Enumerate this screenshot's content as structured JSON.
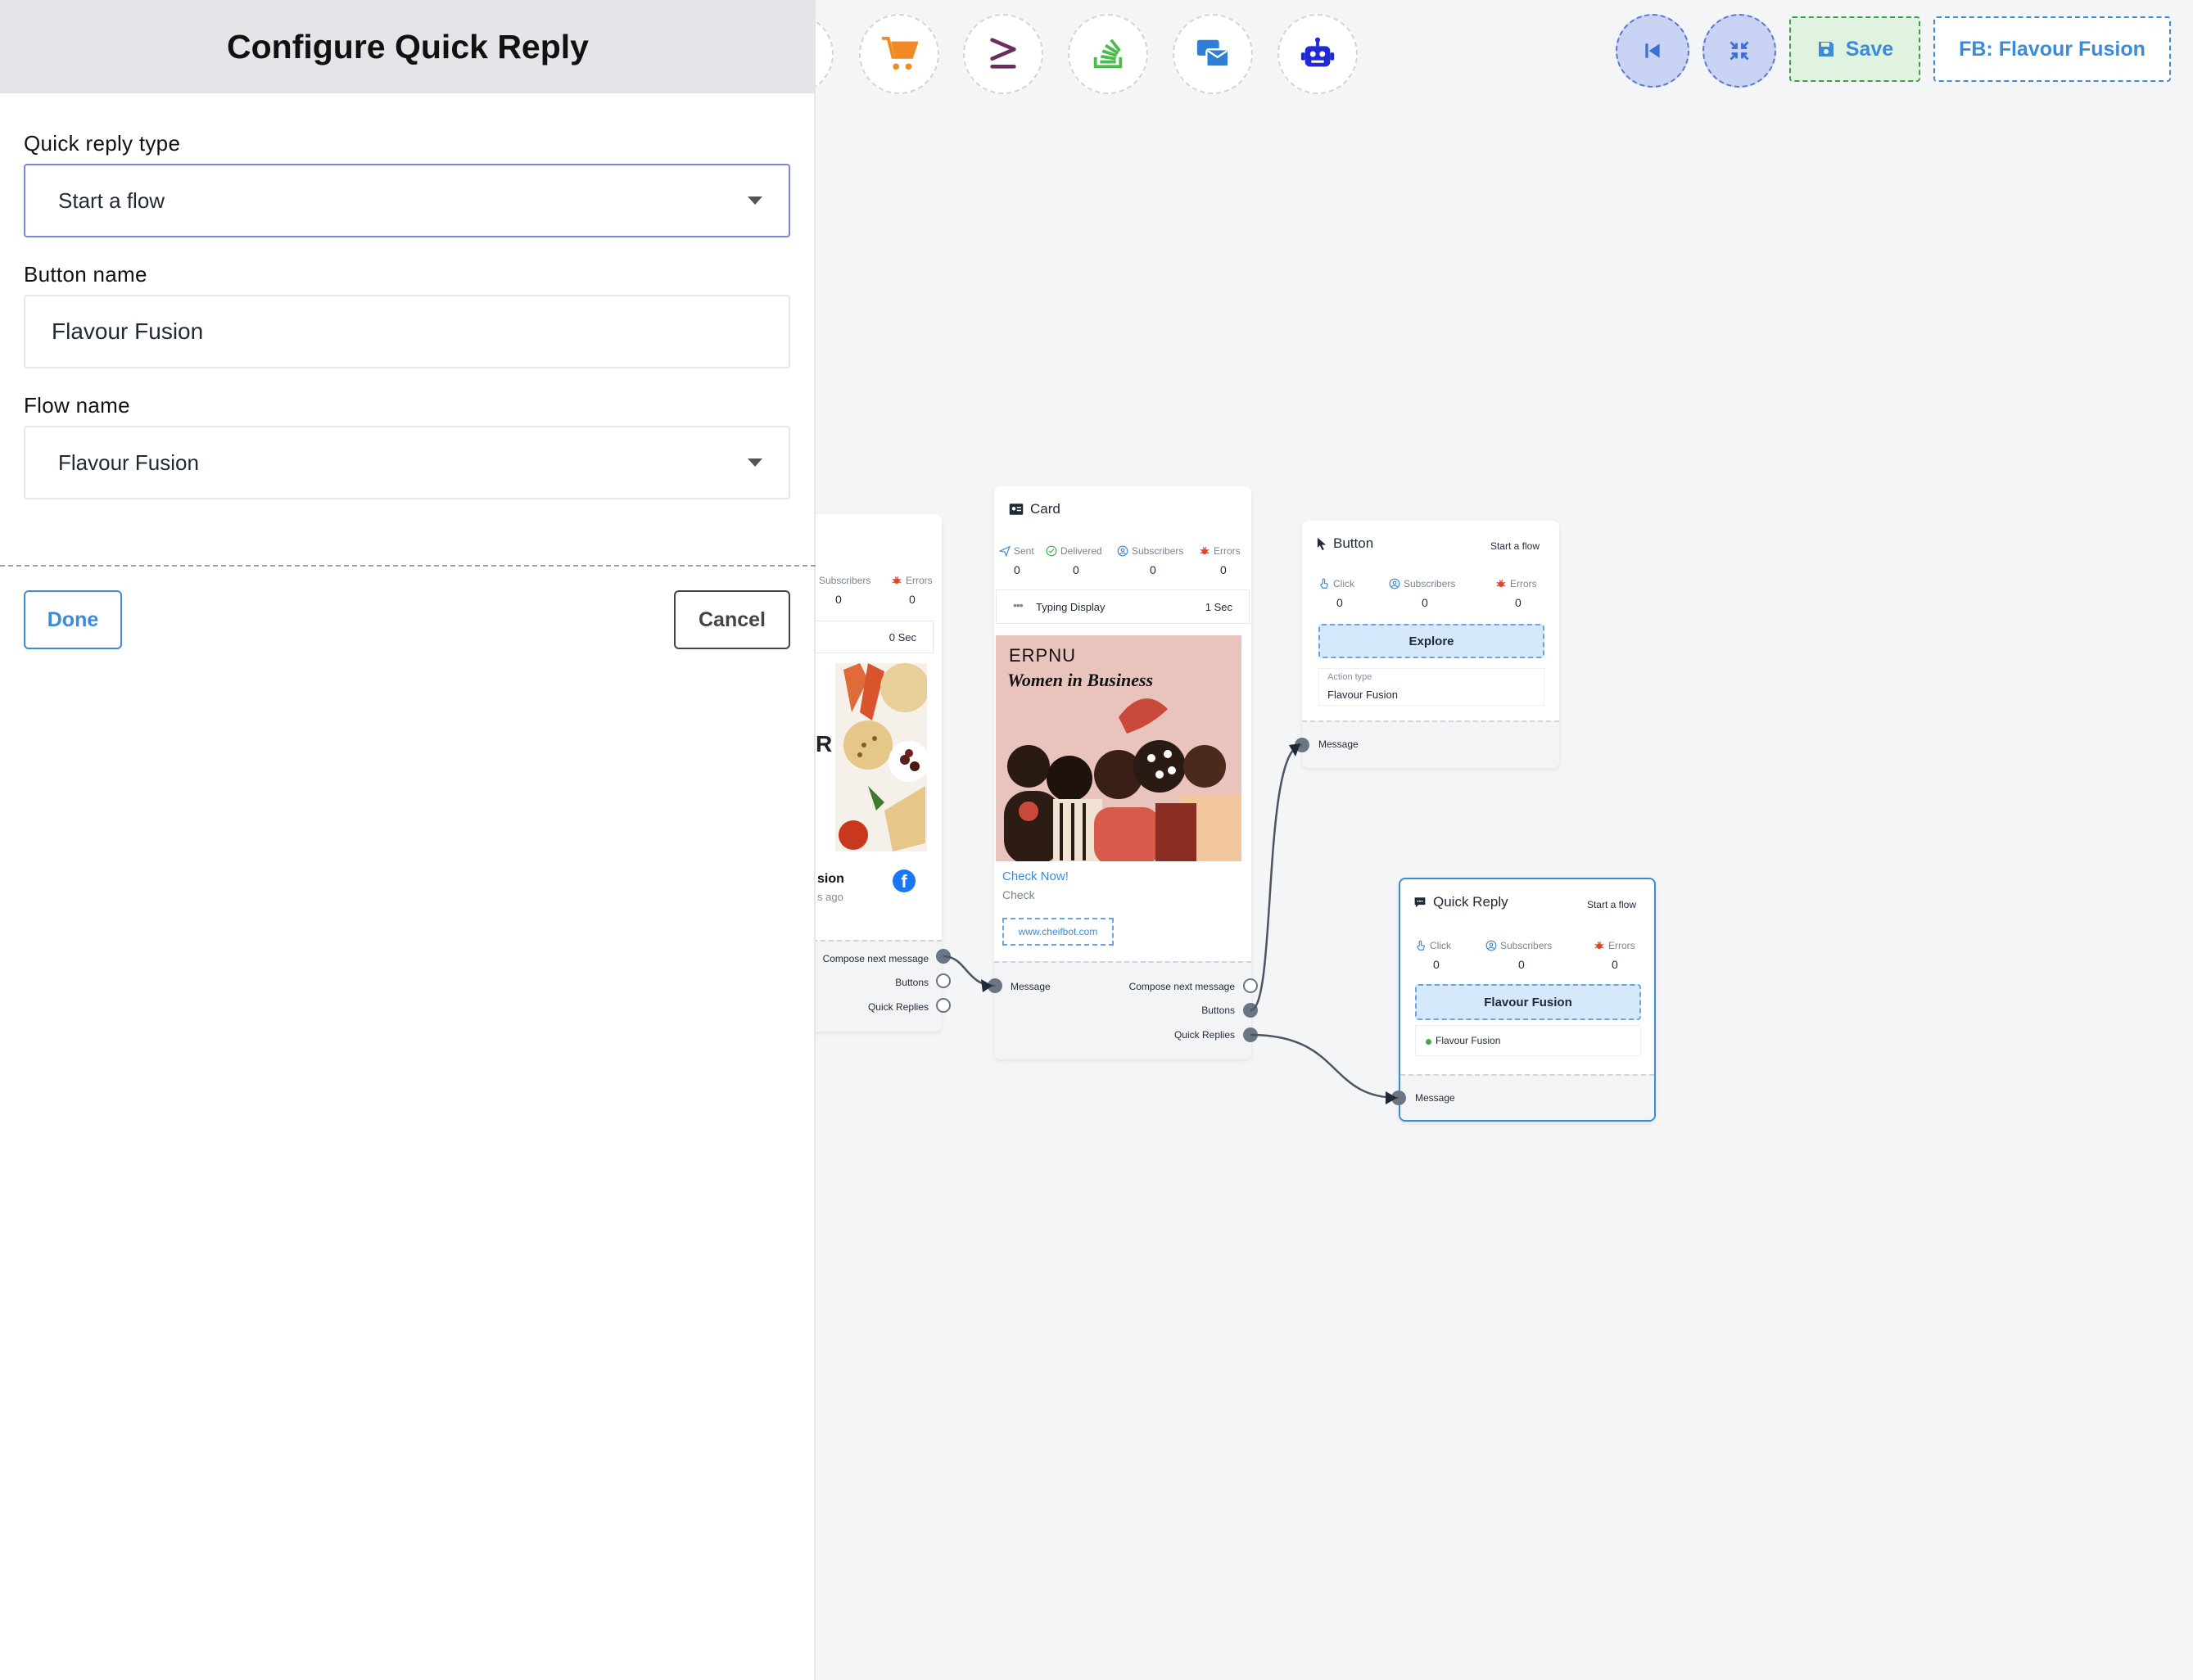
{
  "panel": {
    "title": "Configure Quick Reply",
    "quick_reply_type": {
      "label": "Quick reply type",
      "value": "Start a flow"
    },
    "button_name": {
      "label": "Button name",
      "value": "Flavour Fusion"
    },
    "flow_name": {
      "label": "Flow name",
      "value": "Flavour Fusion"
    },
    "done_label": "Done",
    "cancel_label": "Cancel"
  },
  "toolbar": {
    "tools": [
      "cart-icon",
      "greater-equal-icon",
      "stack-icon",
      "messages-icon",
      "robot-icon"
    ],
    "save_label": "Save",
    "flow_label": "FB: Flavour Fusion",
    "colors": {
      "accent": "#3b8bd9",
      "save_bg": "#dff3e0",
      "round_bg": "#c9d3f3"
    }
  },
  "nodes": {
    "partial": {
      "subscribers_label": "Subscribers",
      "errors_label": "Errors",
      "subscribers_value": "0",
      "errors_value": "0",
      "delay": "0 Sec",
      "title_fragment": "sion",
      "time_fragment": "s ago",
      "ports": [
        "Compose next message",
        "Buttons",
        "Quick Replies"
      ]
    },
    "card": {
      "title": "Card",
      "stats": [
        {
          "label": "Sent",
          "value": "0"
        },
        {
          "label": "Delivered",
          "value": "0"
        },
        {
          "label": "Subscribers",
          "value": "0"
        },
        {
          "label": "Errors",
          "value": "0"
        }
      ],
      "typing_label": "Typing Display",
      "typing_value": "1 Sec",
      "image_heading": "ERPNU",
      "image_subheading": "Women in Business",
      "link_title": "Check Now!",
      "link_subtitle": "Check",
      "url": "www.cheifbot.com",
      "input_port": "Message",
      "ports": [
        "Compose next message",
        "Buttons",
        "Quick Replies"
      ]
    },
    "button": {
      "title": "Button",
      "tag": "Start a flow",
      "stats": [
        {
          "label": "Click",
          "value": "0"
        },
        {
          "label": "Subscribers",
          "value": "0"
        },
        {
          "label": "Errors",
          "value": "0"
        }
      ],
      "chip": "Explore",
      "action_type_label": "Action type",
      "action_type_value": "Flavour Fusion",
      "input_port": "Message"
    },
    "quick_reply": {
      "title": "Quick Reply",
      "tag": "Start a flow",
      "stats": [
        {
          "label": "Click",
          "value": "0"
        },
        {
          "label": "Subscribers",
          "value": "0"
        },
        {
          "label": "Errors",
          "value": "0"
        }
      ],
      "chip": "Flavour Fusion",
      "flow_item": "Flavour Fusion",
      "input_port": "Message"
    }
  }
}
